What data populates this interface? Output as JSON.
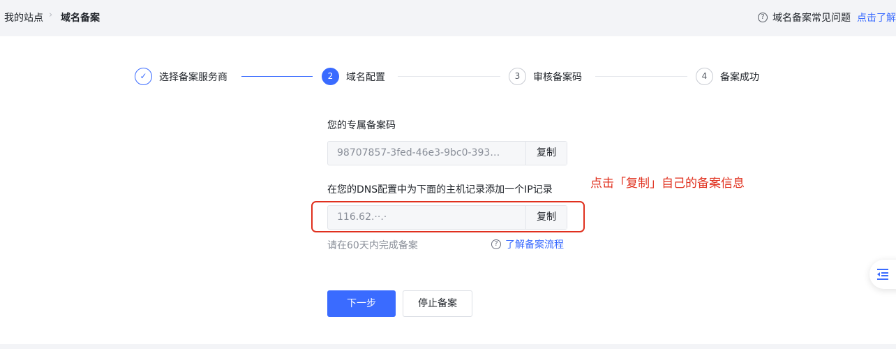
{
  "breadcrumb": {
    "home": "我的站点",
    "separator": "›",
    "current": "域名备案"
  },
  "help": {
    "question_icon": "?",
    "text": "域名备案常见问题",
    "link": "点击了解"
  },
  "steps": [
    {
      "number": "✓",
      "label": "选择备案服务商",
      "state": "done"
    },
    {
      "number": "2",
      "label": "域名配置",
      "state": "active"
    },
    {
      "number": "3",
      "label": "审核备案码",
      "state": "wait"
    },
    {
      "number": "4",
      "label": "备案成功",
      "state": "wait"
    }
  ],
  "code_field": {
    "title": "您的专属备案码",
    "value": "98707857-3fed-46e3-9bc0-393…",
    "copy_label": "复制"
  },
  "ip_field": {
    "title": "在您的DNS配置中为下面的主机记录添加一个IP记录",
    "value": "116.62.··.·",
    "copy_label": "复制"
  },
  "annotation": "点击「复制」自己的备案信息",
  "hint": "请在60天内完成备案",
  "flow_link": {
    "icon": "?",
    "text": "了解备案流程"
  },
  "buttons": {
    "next": "下一步",
    "stop": "停止备案"
  },
  "colors": {
    "accent": "#3a6bff",
    "annotation": "#e0301e"
  },
  "icons": {
    "float_button": "outdent-menu-icon"
  }
}
